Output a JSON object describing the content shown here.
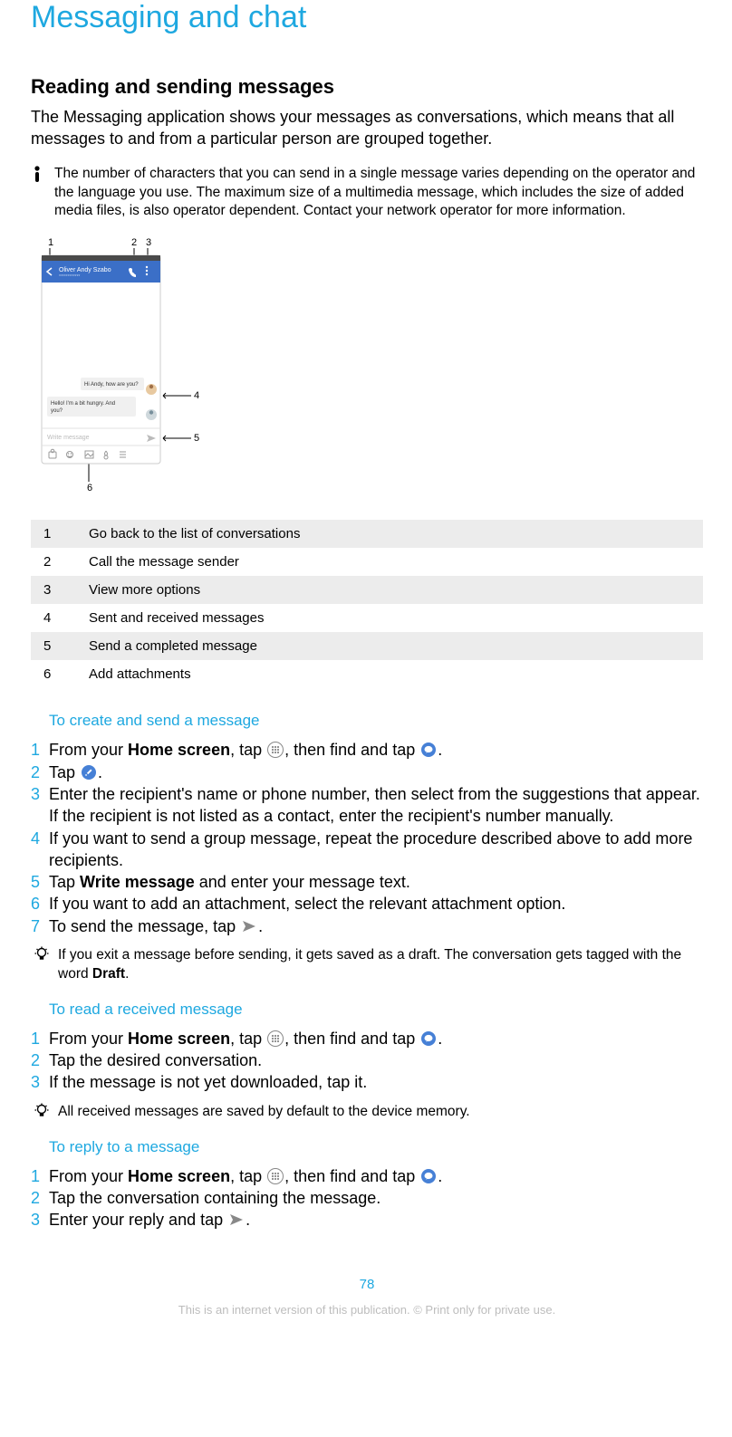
{
  "page": {
    "title": "Messaging and chat",
    "number": "78",
    "footer": "This is an internet version of this publication. © Print only for private use."
  },
  "section": {
    "heading": "Reading and sending messages",
    "intro": "The Messaging application shows your messages as conversations, which means that all messages to and from a particular person are grouped together.",
    "warning": "The number of characters that you can send in a single message varies depending on the operator and the language you use. The maximum size of a multimedia message, which includes the size of added media files, is also operator dependent. Contact your network operator for more information."
  },
  "screenshot": {
    "callouts": [
      "1",
      "2",
      "3",
      "4",
      "5",
      "6"
    ],
    "header_name": "Oliver Andy Szabo",
    "bubble1": "Hi Andy, how are you?",
    "bubble2_line1": "Hello! I'm a bit hungry. And",
    "bubble2_line2": "you?",
    "placeholder": "Write message"
  },
  "legend": [
    {
      "n": "1",
      "desc": "Go back to the list of conversations"
    },
    {
      "n": "2",
      "desc": "Call the message sender"
    },
    {
      "n": "3",
      "desc": "View more options"
    },
    {
      "n": "4",
      "desc": "Sent and received messages"
    },
    {
      "n": "5",
      "desc": "Send a completed message"
    },
    {
      "n": "6",
      "desc": "Add attachments"
    }
  ],
  "proc1": {
    "heading": "To create and send a message",
    "step1_a": "From your ",
    "step1_home": "Home screen",
    "step1_b": ", tap ",
    "step1_c": ", then find and tap ",
    "step1_d": ".",
    "step2_a": "Tap ",
    "step2_b": ".",
    "step3": "Enter the recipient's name or phone number, then select from the suggestions that appear. If the recipient is not listed as a contact, enter the recipient's number manually.",
    "step4": "If you want to send a group message, repeat the procedure described above to add more recipients.",
    "step5_a": "Tap ",
    "step5_bold": "Write message",
    "step5_b": " and enter your message text.",
    "step6": "If you want to add an attachment, select the relevant attachment option.",
    "step7_a": "To send the message, tap ",
    "step7_b": ".",
    "tip_a": "If you exit a message before sending, it gets saved as a draft. The conversation gets tagged with the word ",
    "tip_bold": "Draft",
    "tip_b": "."
  },
  "proc2": {
    "heading": "To read a received message",
    "step1_a": "From your ",
    "step1_home": "Home screen",
    "step1_b": ", tap ",
    "step1_c": ", then find and tap ",
    "step1_d": ".",
    "step2": "Tap the desired conversation.",
    "step3": "If the message is not yet downloaded, tap it.",
    "tip": "All received messages are saved by default to the device memory."
  },
  "proc3": {
    "heading": "To reply to a message",
    "step1_a": "From your ",
    "step1_home": "Home screen",
    "step1_b": ", tap ",
    "step1_c": ", then find and tap ",
    "step1_d": ".",
    "step2": "Tap the conversation containing the message.",
    "step3_a": "Enter your reply and tap ",
    "step3_b": "."
  }
}
